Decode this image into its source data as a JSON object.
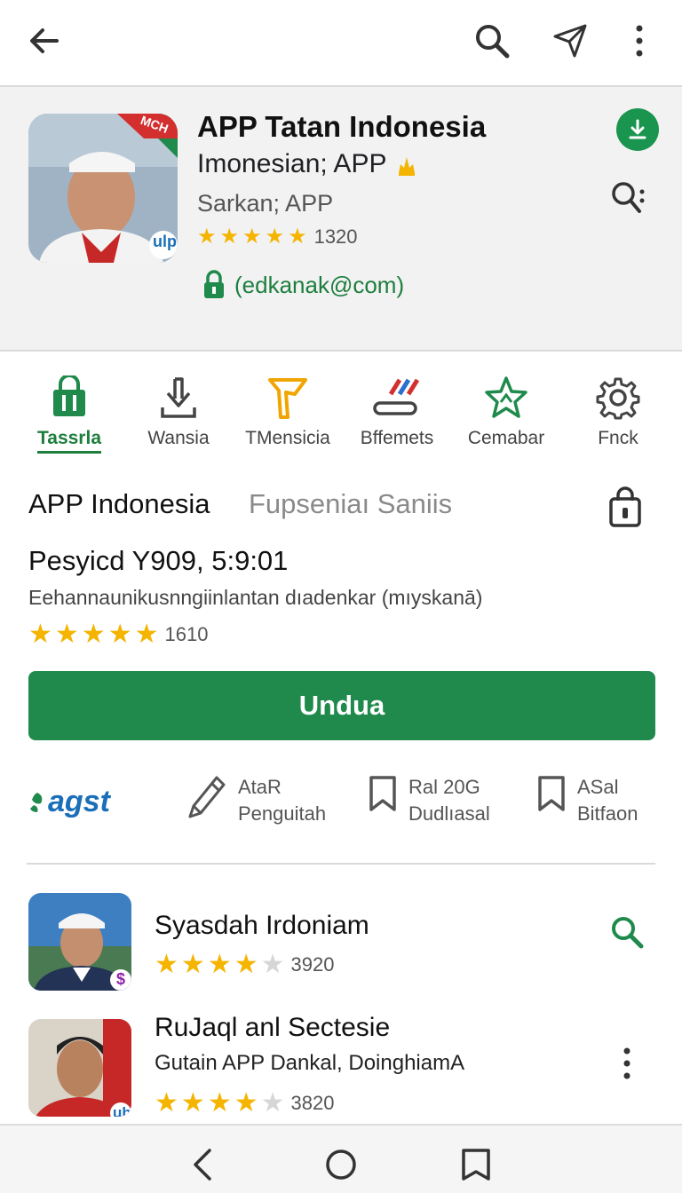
{
  "header": {
    "title": "APP Tatan Indonesia",
    "subtitle": "Imonesian; APP",
    "developer": "Sarkan; APP",
    "rating_count": "1320",
    "rating_stars": 5,
    "email": "(edkanak@com)",
    "icon_badge": "ulp",
    "icon_corner_text": "MCH"
  },
  "categories": [
    {
      "label": "Tassrla",
      "active": true
    },
    {
      "label": "Wansia"
    },
    {
      "label": "TMensicia"
    },
    {
      "label": "Bffemets"
    },
    {
      "label": "Cemabar"
    },
    {
      "label": "Fnck"
    }
  ],
  "tabs": {
    "primary": "APP Indonesia",
    "secondary": "Fupseniaı Saniis"
  },
  "detail": {
    "title": "Pesyicd Y909, 5:9:01",
    "description": "Eehannaunikusnngiinlantan dıadenkar (mıyskanā)",
    "rating_count": "1610",
    "rating_stars": 5
  },
  "install_button": "Undua",
  "meta": {
    "brand": "agst",
    "items": [
      {
        "line1": "AtaR",
        "line2": "Penguitah"
      },
      {
        "line1": "Ral 20G",
        "line2": "Dudlıasal"
      },
      {
        "line1": "ASal",
        "line2": "Bitfaon"
      }
    ]
  },
  "list": [
    {
      "title": "Syasdah Irdoniam",
      "subtitle": "",
      "rating_count": "3920",
      "rating_stars": 4,
      "badge": "$"
    },
    {
      "title": "RuJaql anl Sectesie",
      "subtitle": "Gutain APP Dankal, DoinghiamA",
      "rating_count": "3820",
      "rating_stars": 4,
      "badge": "uh"
    }
  ],
  "colors": {
    "accent_green": "#1f8a4c",
    "star_yellow": "#f4b400",
    "header_bg": "#f2f2f2"
  }
}
